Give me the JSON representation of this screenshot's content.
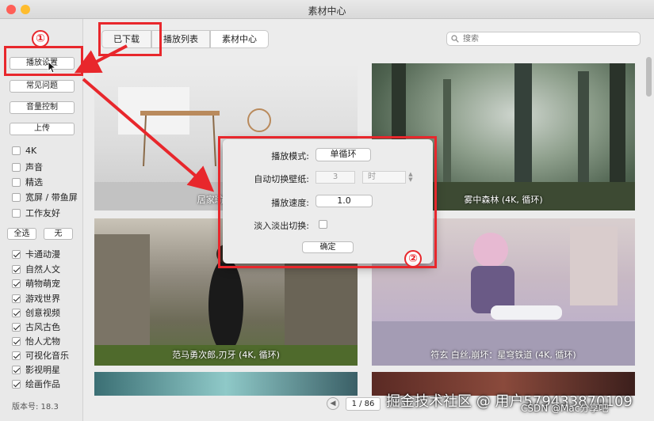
{
  "window": {
    "title": "素材中心"
  },
  "sidebar": {
    "buttons": [
      "播放设置",
      "常见问题",
      "音量控制",
      "上传"
    ],
    "filters": [
      {
        "label": "4K",
        "checked": false
      },
      {
        "label": "声音",
        "checked": false
      },
      {
        "label": "精选",
        "checked": false
      },
      {
        "label": "宽屏 / 带鱼屏",
        "checked": false
      },
      {
        "label": "工作友好",
        "checked": false
      }
    ],
    "select_all": "全选",
    "select_none": "无",
    "categories": [
      {
        "label": "卡通动漫",
        "checked": true
      },
      {
        "label": "自然人文",
        "checked": true
      },
      {
        "label": "萌物萌宠",
        "checked": true
      },
      {
        "label": "游戏世界",
        "checked": true
      },
      {
        "label": "创意视频",
        "checked": true
      },
      {
        "label": "古风古色",
        "checked": true
      },
      {
        "label": "怡人尤物",
        "checked": true
      },
      {
        "label": "可视化音乐",
        "checked": true
      },
      {
        "label": "影视明星",
        "checked": true
      },
      {
        "label": "绘画作品",
        "checked": true
      }
    ],
    "version": "版本号: 18.3"
  },
  "tabs": [
    "已下载",
    "播放列表",
    "素材中心"
  ],
  "active_tab": "素材中心",
  "search": {
    "placeholder": "搜索"
  },
  "tiles": [
    {
      "label": "居家瑜伽, 曾..."
    },
    {
      "label": "雾中森林 (4K, 循环)"
    },
    {
      "label": "范马勇次郎,刃牙 (4K, 循环)"
    },
    {
      "label": "符玄 白丝,崩坏：星穹铁道 (4K, 循环)"
    }
  ],
  "pager": {
    "prev": "◀",
    "text": "1 / 86"
  },
  "dialog": {
    "play_mode_label": "播放模式:",
    "play_mode_value": "单循环",
    "auto_switch_label": "自动切换壁纸:",
    "auto_switch_value": "3",
    "auto_switch_unit": "时",
    "speed_label": "播放速度:",
    "speed_value": "1.0",
    "fade_label": "淡入淡出切换:",
    "fade_checked": false,
    "confirm": "确定"
  },
  "annotations": {
    "one": "①",
    "two": "②",
    "color": "#e8272c"
  },
  "watermark": "掘金技术社区 @ 用户5794338701​09",
  "watermark2": "CSDN @Mac分享吧"
}
